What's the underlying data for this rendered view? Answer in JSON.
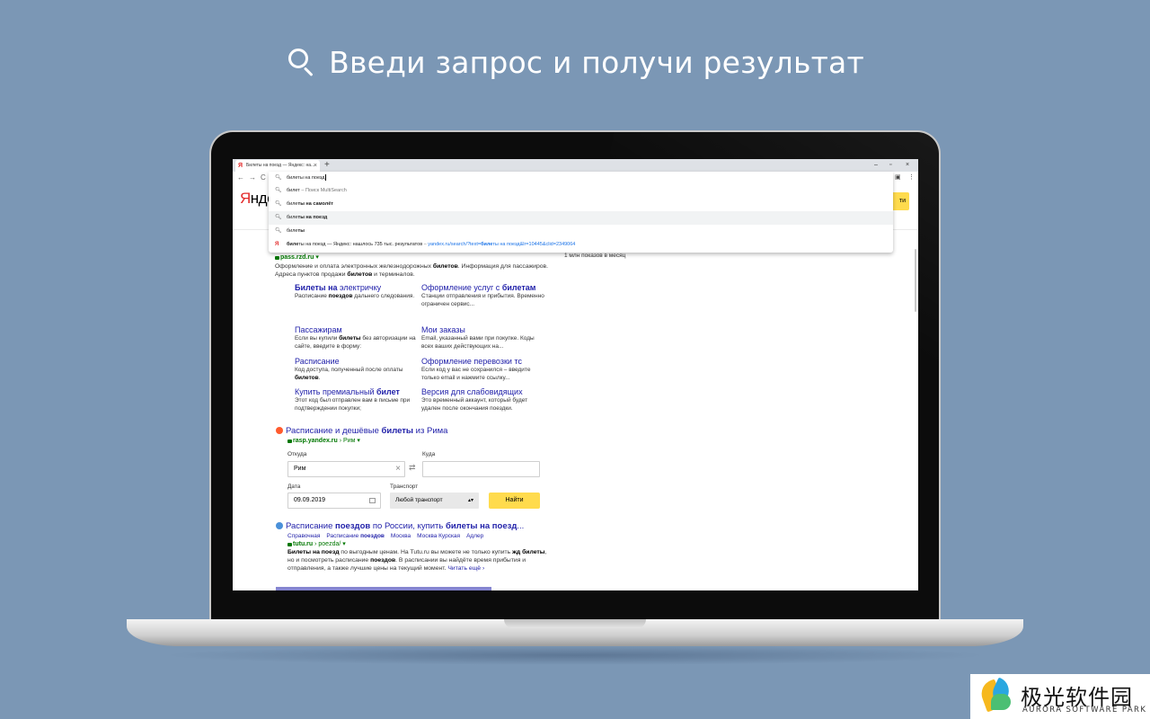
{
  "headline": "Введи запрос и получи результат",
  "browser": {
    "tab_title": "Билеты на поезд — Яндекс: на...",
    "tab_close": "×",
    "new_tab": "+",
    "window_controls": [
      "–",
      "▫",
      "×"
    ],
    "nav": [
      "←",
      "→",
      "C"
    ],
    "toolbar_right": [
      "▣",
      "⋮"
    ]
  },
  "omnibox": {
    "query": "билеты на поезд",
    "suggestions": [
      {
        "pre": "билет",
        "bold": "",
        "post": "",
        "gray": " – Поиск MultiSearch",
        "url": "",
        "highlighted": false
      },
      {
        "pre": "биле",
        "bold": "ты на самолёт",
        "post": "",
        "gray": "",
        "url": "",
        "highlighted": false
      },
      {
        "pre": "биле",
        "bold": "ты на поезд",
        "post": "",
        "gray": "",
        "url": "",
        "highlighted": true
      },
      {
        "pre": "биле",
        "bold": "ты",
        "post": "",
        "gray": "",
        "url": "",
        "highlighted": false
      }
    ],
    "yandex_row": {
      "bold": "биле",
      "text": "ты на поезд — Яндекс: нашлось 735 тыс. результатов",
      "dash": " – ",
      "url_pre": "yandex.ru/search/?text=",
      "url_bold": "биле",
      "url_post": "ты на поезд&lr=10445&clid=2349064"
    }
  },
  "yandex": {
    "logo_first": "Я",
    "logo_rest": "нде",
    "search_button": "ти",
    "monthly": "1 млн показов в месяц"
  },
  "result1": {
    "domain": "pass.rzd.ru",
    "domain_arrow": "▾",
    "snippet_a": "Оформление и оплата электронных железнодорожных ",
    "snippet_b1": "билетов",
    "snippet_c": ". Информация для пассажиров. Адреса пунктов продажи ",
    "snippet_b2": "билетов",
    "snippet_d": " и терминалов.",
    "sitelinks": [
      {
        "t_bold": "Билеты на",
        "t_rest": " электричку",
        "t2_bold": "",
        "desc_a": "Расписание ",
        "desc_b": "поездов",
        "desc_c": " дальнего следования."
      },
      {
        "t_bold": "",
        "t_rest": "Оформление услуг с ",
        "t2_bold": "билетам",
        "desc_a": "Станции отправления и прибытия. Временно ограничен сервис...",
        "desc_b": "",
        "desc_c": ""
      },
      {
        "t_bold": "",
        "t_rest": "Пассажирам",
        "t2_bold": "",
        "desc_a": "Если вы купили ",
        "desc_b": "билеты",
        "desc_c": " без авторизации на сайте, введите в форму:"
      },
      {
        "t_bold": "",
        "t_rest": "Мои заказы",
        "t2_bold": "",
        "desc_a": "Email, указанный вами при покупке. Коды всех ваших действующих на...",
        "desc_b": "",
        "desc_c": ""
      },
      {
        "t_bold": "",
        "t_rest": "Расписание",
        "t2_bold": "",
        "desc_a": "Код доступа, полученный после оплаты ",
        "desc_b": "билетов",
        "desc_c": "."
      },
      {
        "t_bold": "",
        "t_rest": "Оформление перевозки тс",
        "t2_bold": "",
        "desc_a": "Если код у вас не сохранился – введите только email и нажмите ссылку...",
        "desc_b": "",
        "desc_c": ""
      },
      {
        "t_bold": "",
        "t_rest": "Купить премиальный ",
        "t2_bold": "билет",
        "desc_a": "Этот код был отправлен вам в письме при подтверждении покупки;",
        "desc_b": "",
        "desc_c": ""
      },
      {
        "t_bold": "",
        "t_rest": "Версия для слабовидящих",
        "t2_bold": "",
        "desc_a": "Это временный аккаунт, который будет удален после окончания поездки.",
        "desc_b": "",
        "desc_c": ""
      }
    ]
  },
  "result2": {
    "title_a": "Расписание и дешёвые ",
    "title_b": "билеты",
    "title_c": " из Рима",
    "domain": "rasp.yandex.ru",
    "path": " › Рим ▾",
    "from_label": "Откуда",
    "from_value": "Рим",
    "clear": "×",
    "swap": "⇄",
    "to_label": "Куда",
    "to_value": "",
    "date_label": "Дата",
    "date_value": "09.09.2019",
    "transport_label": "Транспорт",
    "transport_value": "Любой транспорт",
    "transport_arrow": "▴▾",
    "find_button": "Найти"
  },
  "result3": {
    "title_a": "Расписание ",
    "title_b1": "поездов",
    "title_c": " по России, купить ",
    "title_b2": "билеты на поезд",
    "title_d": "...",
    "breadcrumbs": [
      "Справочная",
      "Расписание ",
      "поездов",
      "Москва",
      "Москва Курская",
      "Адлер"
    ],
    "domain": "tutu.ru",
    "path": " › poezda/ ▾",
    "sn_b1": "Билеты на поезд",
    "sn_a": " по выгодным ценам. На Tutu.ru вы можете не только купить ",
    "sn_b2": "жд билеты",
    "sn_c": ", но и посмотреть расписание ",
    "sn_b3": "поездов",
    "sn_d": ". В расписании вы найдёте время прибытия и отправления, а также лучшие цены на текущий момент. ",
    "more": "Читать ещё ›"
  },
  "watermark": {
    "cn": "极光软件园",
    "en": "AURORA SOFTWARE PARK"
  }
}
